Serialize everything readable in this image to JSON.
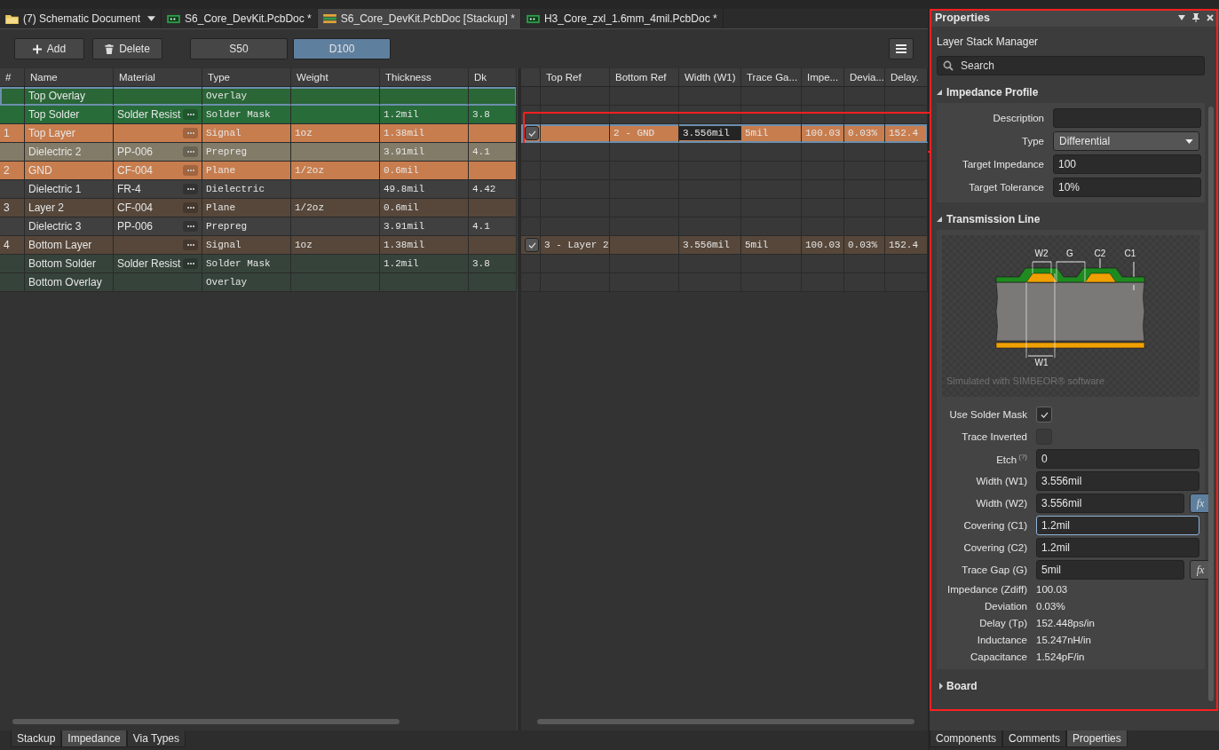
{
  "doc_tabs": [
    {
      "label": "(7) Schematic Document",
      "kind": "folder",
      "dropdown": true,
      "selected": false
    },
    {
      "label": "S6_Core_DevKit.PcbDoc *",
      "kind": "pcb",
      "dropdown": false,
      "selected": false
    },
    {
      "label": "S6_Core_DevKit.PcbDoc [Stackup] *",
      "kind": "stackup",
      "dropdown": false,
      "selected": true
    },
    {
      "label": "H3_Core_zxl_1.6mm_4mil.PcbDoc *",
      "kind": "pcb",
      "dropdown": false,
      "selected": false
    }
  ],
  "toolbar": {
    "buttons": [
      {
        "label": "Add",
        "kind": "add"
      },
      {
        "label": "Delete",
        "kind": "delete"
      }
    ],
    "profiles": [
      {
        "label": "S50",
        "selected": false
      },
      {
        "label": "D100",
        "selected": true
      }
    ]
  },
  "stack_table": {
    "columns": [
      "#",
      "Name",
      "Material",
      "Type",
      "Weight",
      "Thickness",
      "Dk"
    ],
    "impedance_columns": [
      "Top Ref",
      "Bottom Ref",
      "Width (W1)",
      "Trace Ga...",
      "Impe...",
      "Devia...",
      "Delay."
    ],
    "rows": [
      {
        "name": "Top Overlay",
        "type": "Overlay",
        "picker": false,
        "color": "#2a6636",
        "selected": true
      },
      {
        "name": "Top Solder",
        "material": "Solder Resist",
        "type": "Solder Mask",
        "thickness": "1.2mil",
        "dk": "3.8",
        "picker": true,
        "color": "#276c39",
        "selected": false
      },
      {
        "number": "1",
        "name": "Top Layer",
        "type": "Signal",
        "weight": "1oz",
        "thickness": "1.38mil",
        "picker": true,
        "color": "#c87d4e",
        "selected": false,
        "impedance": {
          "checked": true,
          "selected": true,
          "bottom_ref": "2 - GND",
          "width": "3.556mil",
          "width_focused": true,
          "gap": "5mil",
          "impedance": "100.03",
          "deviation": "0.03%",
          "delay": "152.4"
        }
      },
      {
        "name": "Dielectric 2",
        "material": "PP-006",
        "type": "Prepreg",
        "thickness": "3.91mil",
        "dk": "4.1",
        "picker": true,
        "color": "#827b67",
        "selected": false
      },
      {
        "number": "2",
        "name": "GND",
        "material": "CF-004",
        "type": "Plane",
        "weight": "1/2oz",
        "thickness": "0.6mil",
        "picker": true,
        "color": "#c87d4e",
        "selected": false
      },
      {
        "name": "Dielectric 1",
        "material": "FR-4",
        "type": "Dielectric",
        "thickness": "49.8mil",
        "dk": "4.42",
        "picker": true,
        "color": "#3f3f3f",
        "selected": false
      },
      {
        "number": "3",
        "name": "Layer 2",
        "material": "CF-004",
        "type": "Plane",
        "weight": "1/2oz",
        "thickness": "0.6mil",
        "picker": true,
        "color": "#56473a",
        "selected": false
      },
      {
        "name": "Dielectric 3",
        "material": "PP-006",
        "type": "Prepreg",
        "thickness": "3.91mil",
        "dk": "4.1",
        "picker": true,
        "color": "#404040",
        "selected": false
      },
      {
        "number": "4",
        "name": "Bottom Layer",
        "type": "Signal",
        "weight": "1oz",
        "thickness": "1.38mil",
        "picker": true,
        "color": "#56473a",
        "selected": false,
        "impedance": {
          "checked": true,
          "selected": false,
          "top_ref": "3 - Layer 2",
          "width": "3.556mil",
          "width_focused": false,
          "gap": "5mil",
          "impedance": "100.03",
          "deviation": "0.03%",
          "delay": "152.4"
        }
      },
      {
        "name": "Bottom Solder",
        "material": "Solder Resist",
        "type": "Solder Mask",
        "thickness": "1.2mil",
        "dk": "3.8",
        "picker": true,
        "color": "#36433a",
        "selected": false
      },
      {
        "name": "Bottom Overlay",
        "type": "Overlay",
        "picker": false,
        "color": "#36433a",
        "selected": false
      }
    ]
  },
  "view_tabs": [
    {
      "label": "Stackup",
      "selected": false
    },
    {
      "label": "Impedance",
      "selected": true
    },
    {
      "label": "Via Types",
      "selected": false
    }
  ],
  "properties": {
    "title": "Properties",
    "subtitle": "Layer Stack Manager",
    "search": {
      "placeholder": "Search"
    },
    "sections": [
      {
        "title": "Impedance Profile",
        "expanded": true,
        "fields": [
          {
            "label": "Description",
            "kind": "text"
          },
          {
            "label": "Type",
            "kind": "select",
            "value": "Differential"
          },
          {
            "label": "Target Impedance",
            "kind": "text",
            "value": "100"
          },
          {
            "label": "Target Tolerance",
            "kind": "text",
            "value": "10%"
          }
        ]
      },
      {
        "title": "Transmission Line",
        "expanded": true,
        "diagram": {
          "labels": [
            "W2",
            "G",
            "C2",
            "C1",
            "W1"
          ],
          "caption": "Simulated with SIMBEOR® software"
        },
        "fields": [
          {
            "label": "Use Solder Mask",
            "kind": "checkbox",
            "checked": true
          },
          {
            "label": "Trace Inverted",
            "kind": "checkbox",
            "checked": false
          },
          {
            "label": "Etch",
            "kind": "text",
            "value": "0",
            "help": "(?)"
          },
          {
            "label": "Width (W1)",
            "kind": "text",
            "value": "3.556mil"
          },
          {
            "label": "Width (W2)",
            "kind": "text",
            "value": "3.556mil",
            "formula": {
              "label": "fx",
              "active": true
            }
          },
          {
            "label": "Covering (C1)",
            "kind": "text",
            "value": "1.2mil",
            "focused": true
          },
          {
            "label": "Covering (C2)",
            "kind": "text",
            "value": "1.2mil"
          },
          {
            "label": "Trace Gap (G)",
            "kind": "text",
            "value": "5mil",
            "formula": {
              "label": "fx",
              "active": false
            }
          },
          {
            "label": "Impedance (Zdiff)",
            "kind": "readout",
            "value": "100.03"
          },
          {
            "label": "Deviation",
            "kind": "readout",
            "value": "0.03%"
          },
          {
            "label": "Delay (Tp)",
            "kind": "readout",
            "value": "152.448ps/in"
          },
          {
            "label": "Inductance",
            "kind": "readout",
            "value": "15.247nH/in"
          },
          {
            "label": "Capacitance",
            "kind": "readout",
            "value": "1.524pF/in"
          }
        ]
      },
      {
        "title": "Board",
        "expanded": false
      }
    ]
  },
  "panel_tabs": [
    {
      "label": "Components",
      "selected": false
    },
    {
      "label": "Comments",
      "selected": false
    },
    {
      "label": "Properties",
      "selected": true
    }
  ]
}
